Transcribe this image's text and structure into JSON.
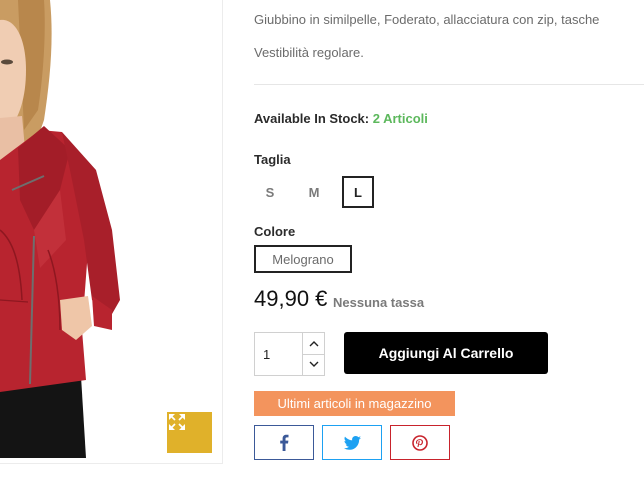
{
  "description": {
    "line1": "Giubbino in similpelle, Foderato, allacciatura con zip, tasche",
    "line2": "Vestibilità regolare."
  },
  "stock": {
    "label": "Available In Stock:",
    "quantity": "2 Articoli"
  },
  "size": {
    "label": "Taglia",
    "options": [
      "S",
      "M",
      "L"
    ],
    "selected": "L"
  },
  "color": {
    "label": "Colore",
    "options": [
      "Melograno"
    ],
    "selected": "Melograno"
  },
  "price": {
    "amount": "49,90 €",
    "tax_note": "Nessuna tassa"
  },
  "quantity": {
    "value": "1"
  },
  "cart": {
    "add_label": "Aggiungi Al Carrello"
  },
  "badge": {
    "label": "Ultimi articoli in magazzino"
  },
  "icons": {
    "zoom": "expand-icon",
    "facebook": "facebook-icon",
    "twitter": "twitter-icon",
    "pinterest": "pinterest-icon",
    "qty_up": "chevron-up-icon",
    "qty_down": "chevron-down-icon"
  },
  "colors": {
    "accent_zoom": "#e0b12a",
    "stock_green": "#5cb85c",
    "badge_orange": "#f3945d",
    "jacket_red": "#b8242f",
    "facebook": "#3b5998",
    "twitter": "#1da1f2",
    "pinterest": "#c8232c"
  }
}
